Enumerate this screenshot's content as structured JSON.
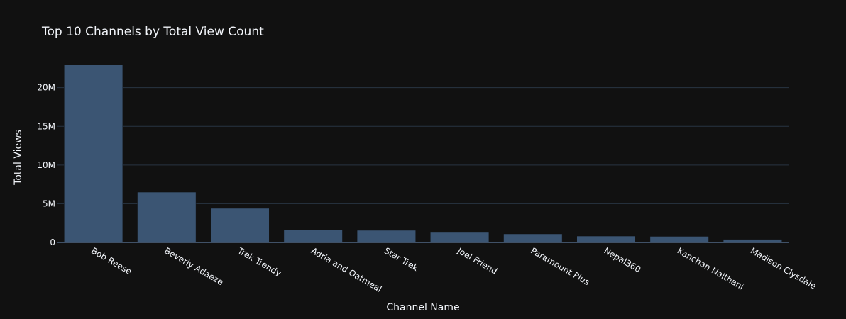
{
  "chart_data": {
    "type": "bar",
    "title": "Top 10 Channels by Total View Count",
    "xlabel": "Channel Name",
    "ylabel": "Total Views",
    "categories": [
      "Bob Reese",
      "Beverly Adaeze",
      "Trek Trendy",
      "Adria and Oatmeal",
      "Star Trek",
      "Joel Friend",
      "Paramount Plus",
      "Nepal360",
      "Kanchan Naithani",
      "Madison Clysdale"
    ],
    "values": [
      22950000,
      6500000,
      4400000,
      1600000,
      1560000,
      1380000,
      1100000,
      820000,
      780000,
      400000
    ],
    "ylim": [
      0,
      24000000
    ],
    "yticks": [
      0,
      5000000,
      10000000,
      15000000,
      20000000
    ],
    "ytick_labels": [
      "0",
      "5M",
      "10M",
      "15M",
      "20M"
    ],
    "grid": true,
    "bar_color": "#3b5573",
    "background_color": "#111111",
    "gridline_color": "#283442",
    "text_color": "#f2f5fa"
  }
}
